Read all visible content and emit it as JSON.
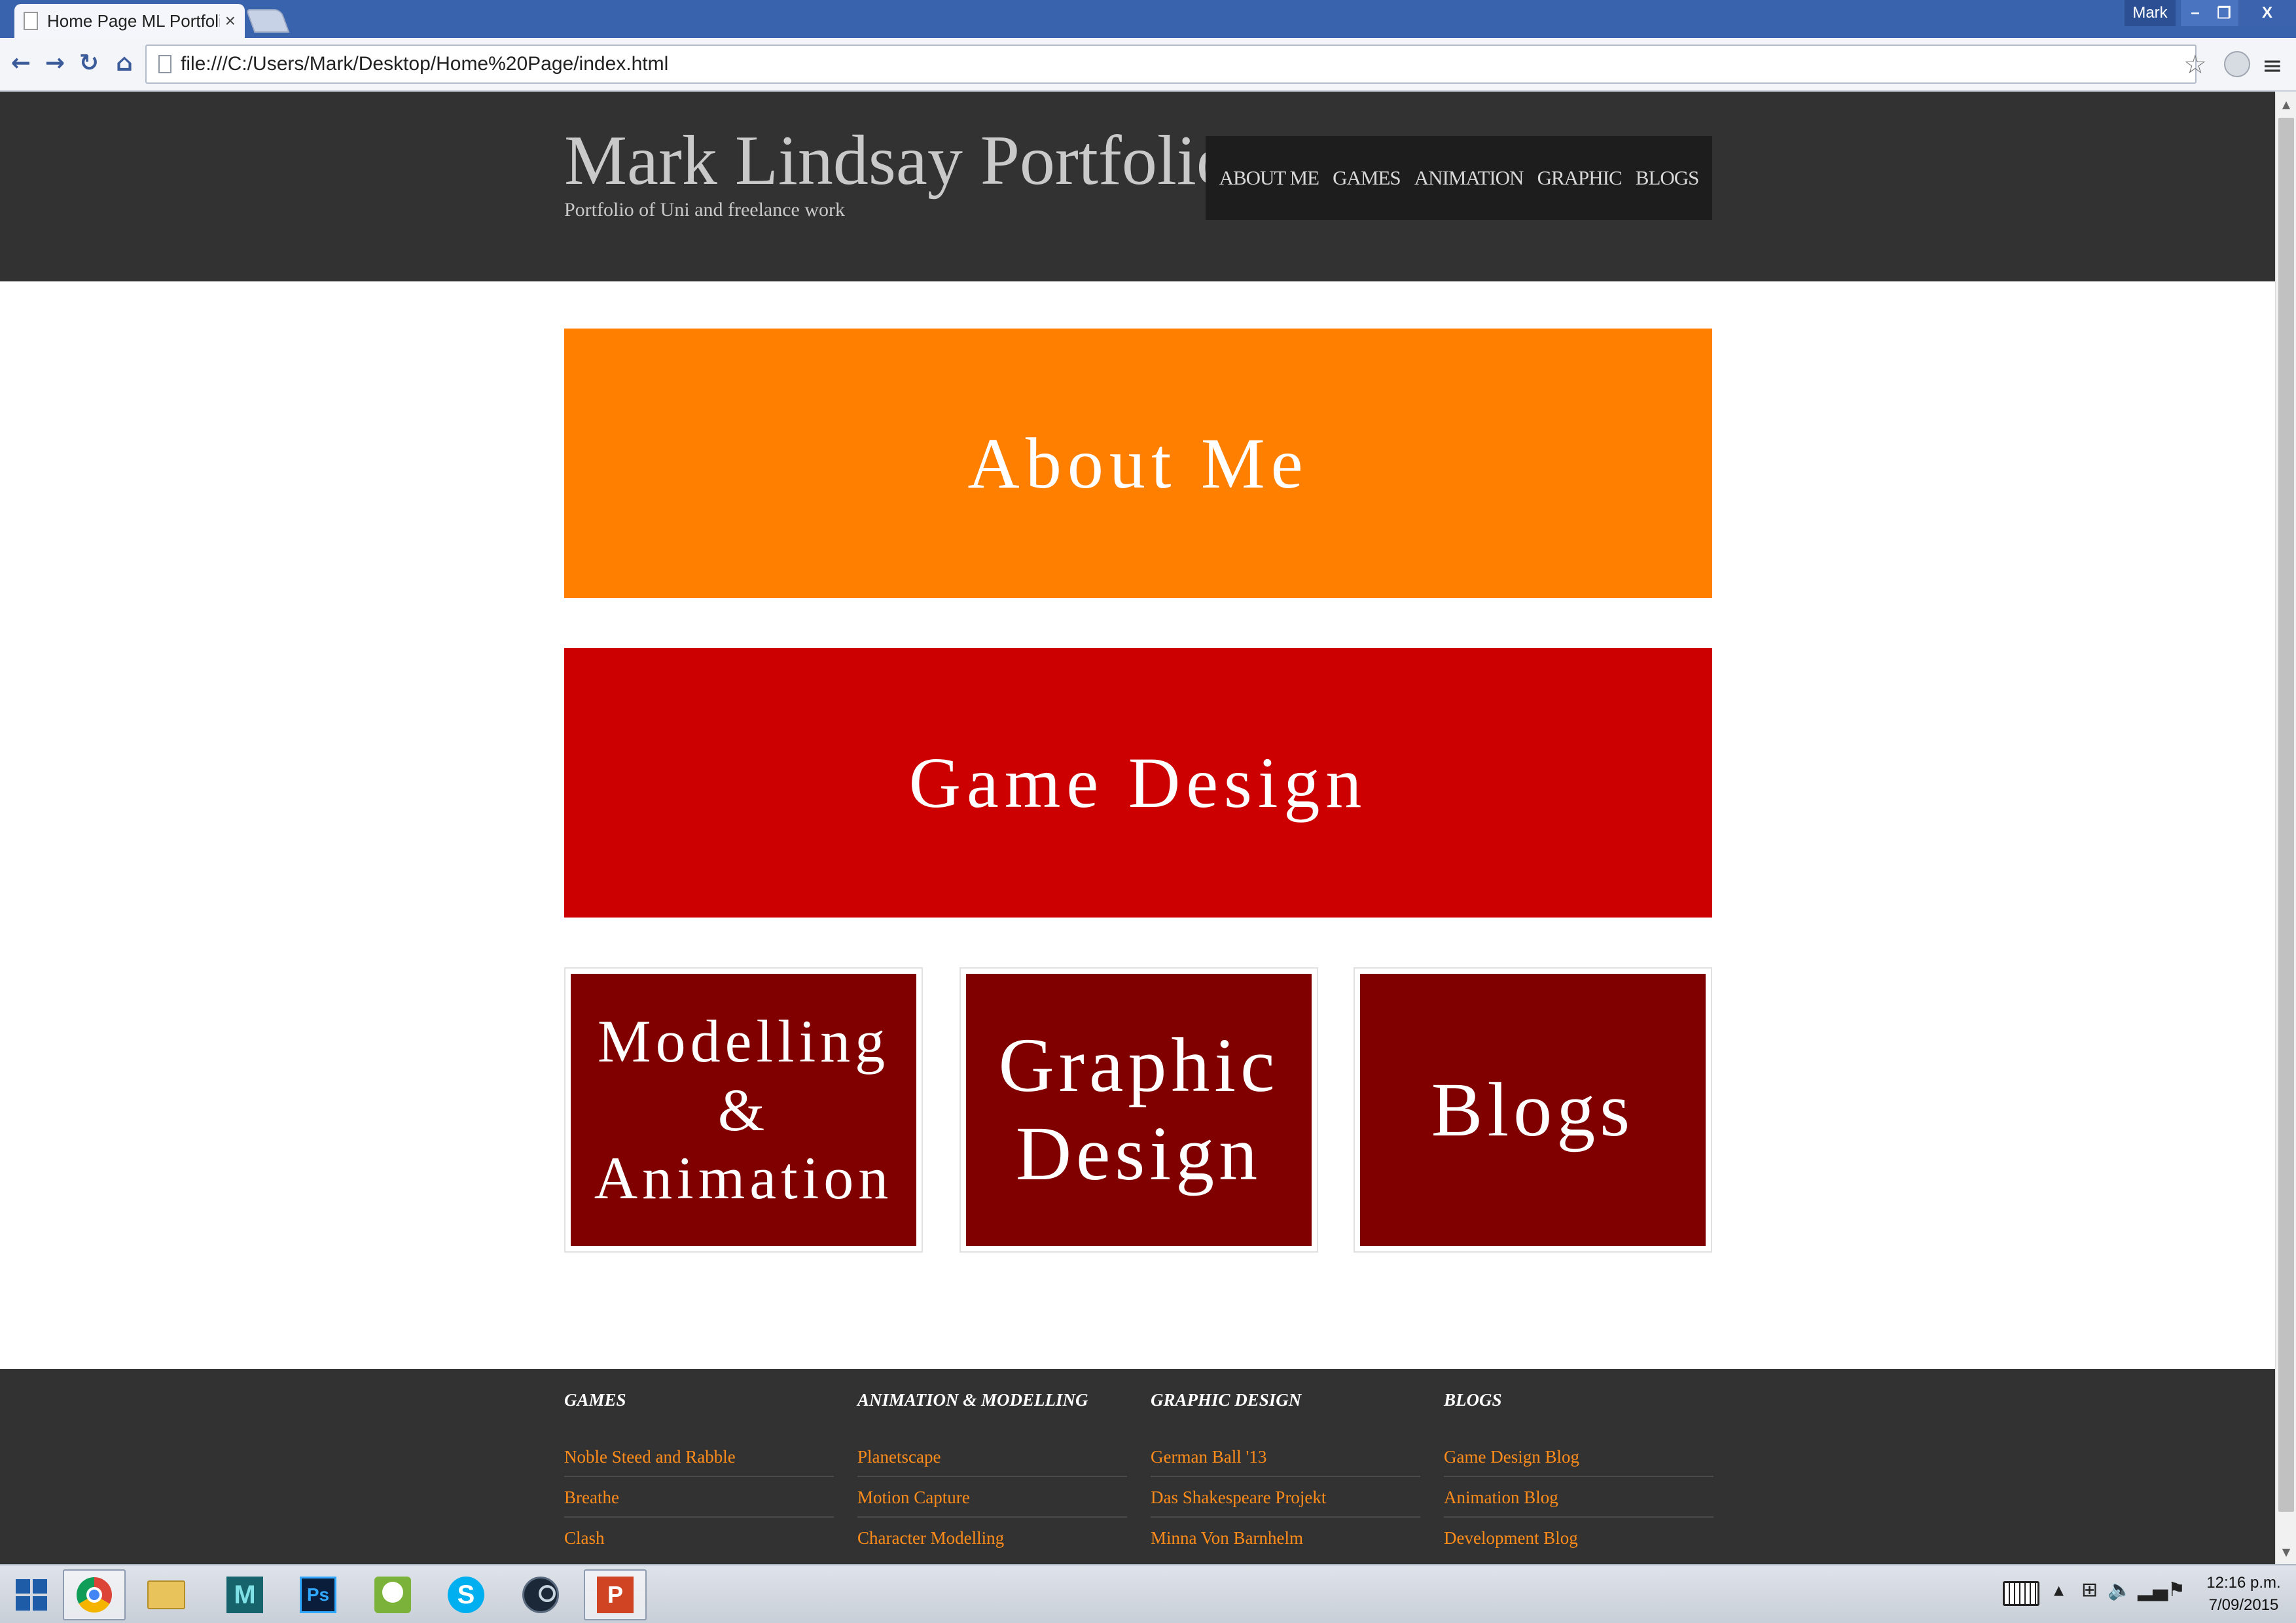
{
  "browser": {
    "tab_title": "Home Page ML Portfolio",
    "tab_close": "×",
    "user_name": "Mark",
    "window_min": "–",
    "window_max": "❐",
    "window_close": "X",
    "address": "file:///C:/Users/Mark/Desktop/Home%20Page/index.html",
    "icons": [
      "back-icon",
      "forward-icon",
      "reload-icon",
      "home-icon",
      "star-icon",
      "extension-icon",
      "menu-icon"
    ]
  },
  "header": {
    "title": "Mark Lindsay Portfolio",
    "tagline": "Portfolio of Uni and freelance work",
    "nav": [
      "ABOUT ME",
      "GAMES",
      "ANIMATION",
      "GRAPHIC",
      "BLOGS"
    ]
  },
  "tiles": {
    "about": "About Me",
    "games": "Game Design",
    "anim_line1": "Modelling &",
    "anim_line2": "Animation",
    "graphic_line1": "Graphic",
    "graphic_line2": "Design",
    "blogs": "Blogs"
  },
  "colors": {
    "header_bg": "#323232",
    "about_tile": "#ff7f00",
    "games_tile": "#cc0000",
    "small_tiles": "#800000",
    "footer_link": "#ff8c1a"
  },
  "footer": {
    "columns": [
      {
        "heading": "GAMES",
        "links": [
          "Noble Steed and Rabble",
          "Breathe",
          "Clash"
        ]
      },
      {
        "heading": "ANIMATION & MODELLING",
        "links": [
          "Planetscape",
          "Motion Capture",
          "Character Modelling"
        ]
      },
      {
        "heading": "GRAPHIC DESIGN",
        "links": [
          "German Ball '13",
          "Das Shakespeare Projekt",
          "Minna Von Barnhelm"
        ]
      },
      {
        "heading": "BLOGS",
        "links": [
          "Game Design Blog",
          "Animation Blog",
          "Development Blog"
        ]
      }
    ]
  },
  "taskbar": {
    "apps": [
      "start-icon",
      "chrome-icon",
      "file-explorer-icon",
      "maya-icon",
      "photoshop-icon",
      "tree-app-icon",
      "skype-icon",
      "steam-icon",
      "powerpoint-icon"
    ],
    "maya_letter": "M",
    "ps_label": "Ps",
    "skype_letter": "S",
    "ppt_letter": "P",
    "clock_time": "12:16 p.m.",
    "clock_date": "7/09/2015"
  }
}
